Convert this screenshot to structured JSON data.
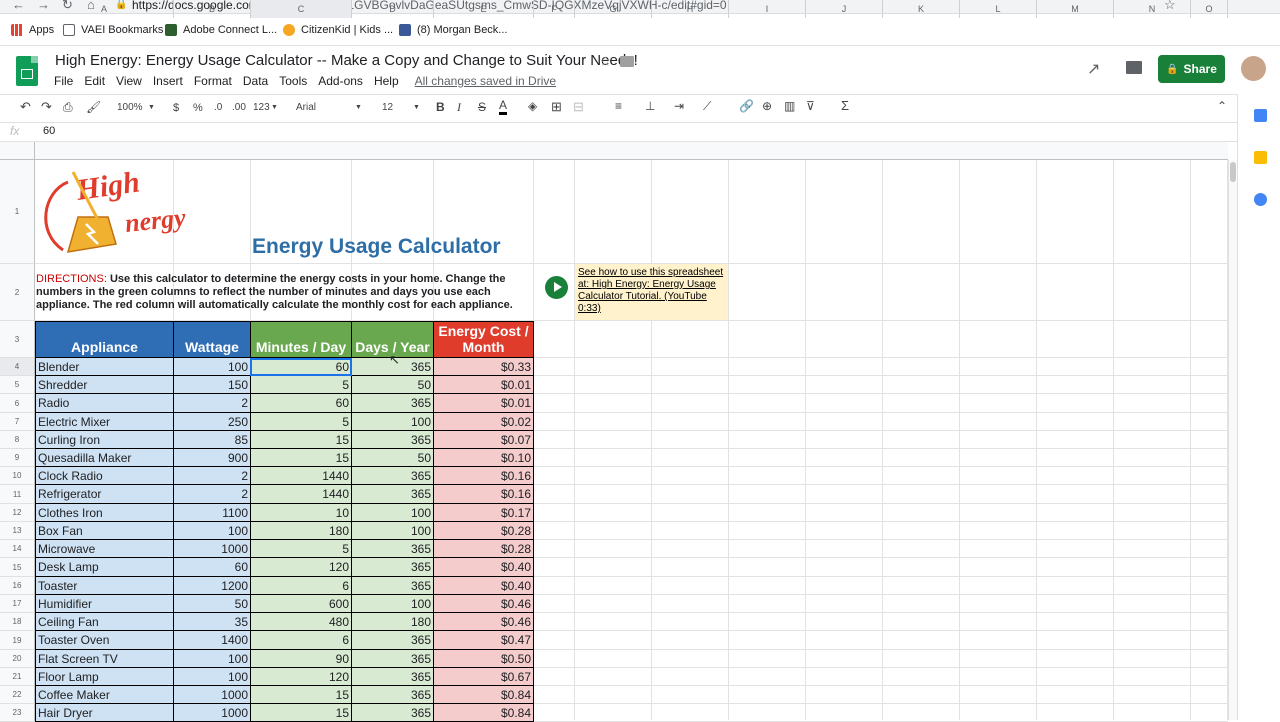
{
  "browser": {
    "url_host": "https://docs.google.com",
    "url_path": "/spreadsheets/d/1GVBGovlvDaGeaSUtgsms_CmwSD-IQGXMzeVqjVXWH-c/edit#gid=0",
    "bookmarks": [
      "Apps",
      "VAEI Bookmarks",
      "Adobe Connect L...",
      "CitizenKid | Kids ...",
      "(8) Morgan Beck..."
    ]
  },
  "doc": {
    "title": "High Energy: Energy Usage Calculator -- Make a Copy and Change to Suit Your Needs!",
    "menu": [
      "File",
      "Edit",
      "View",
      "Insert",
      "Format",
      "Data",
      "Tools",
      "Add-ons",
      "Help"
    ],
    "saved_status": "All changes saved in Drive",
    "share_label": "Share"
  },
  "toolbar": {
    "zoom": "100%",
    "currency": "$",
    "percent": "%",
    "dec_less": ".0",
    "dec_more": ".00",
    "more_formats": "123",
    "font": "Arial",
    "font_size": "12",
    "bold": "B",
    "italic": "I",
    "strike": "S",
    "textcolor": "A",
    "sum": "Σ"
  },
  "formula_bar": {
    "fx": "fx",
    "value": "60"
  },
  "columns": [
    "A",
    "B",
    "C",
    "D",
    "E",
    "F",
    "G",
    "H",
    "I",
    "J",
    "K",
    "L",
    "M",
    "N",
    "O"
  ],
  "sheet": {
    "logo_text_1": "High",
    "logo_text_2": "nergy",
    "title": "Energy Usage Calculator",
    "directions_label": "DIRECTIONS:",
    "directions_text": "Use this calculator to determine the energy costs in your home. Change the numbers in the green columns to reflect the number of minutes and days you use each appliance. The red column will automatically calculate the monthly cost for each appliance.",
    "note": "See how to use this spreadsheet at: High Energy: Energy Usage Calculator Tutorial. (YouTube 0:33)",
    "headers": [
      "Appliance",
      "Wattage",
      "Minutes / Day",
      "Days / Year",
      "Energy Cost / Month"
    ],
    "rows": [
      [
        "Blender",
        "100",
        "60",
        "365",
        "$0.33"
      ],
      [
        "Shredder",
        "150",
        "5",
        "50",
        "$0.01"
      ],
      [
        "Radio",
        "2",
        "60",
        "365",
        "$0.01"
      ],
      [
        "Electric Mixer",
        "250",
        "5",
        "100",
        "$0.02"
      ],
      [
        "Curling Iron",
        "85",
        "15",
        "365",
        "$0.07"
      ],
      [
        "Quesadilla Maker",
        "900",
        "15",
        "50",
        "$0.10"
      ],
      [
        "Clock Radio",
        "2",
        "1440",
        "365",
        "$0.16"
      ],
      [
        "Refrigerator",
        "2",
        "1440",
        "365",
        "$0.16"
      ],
      [
        "Clothes Iron",
        "1100",
        "10",
        "100",
        "$0.17"
      ],
      [
        "Box Fan",
        "100",
        "180",
        "100",
        "$0.28"
      ],
      [
        "Microwave",
        "1000",
        "5",
        "365",
        "$0.28"
      ],
      [
        "Desk Lamp",
        "60",
        "120",
        "365",
        "$0.40"
      ],
      [
        "Toaster",
        "1200",
        "6",
        "365",
        "$0.40"
      ],
      [
        "Humidifier",
        "50",
        "600",
        "100",
        "$0.46"
      ],
      [
        "Ceiling Fan",
        "35",
        "480",
        "180",
        "$0.46"
      ],
      [
        "Toaster Oven",
        "1400",
        "6",
        "365",
        "$0.47"
      ],
      [
        "Flat Screen TV",
        "100",
        "90",
        "365",
        "$0.50"
      ],
      [
        "Floor Lamp",
        "100",
        "120",
        "365",
        "$0.67"
      ],
      [
        "Coffee Maker",
        "1000",
        "15",
        "365",
        "$0.84"
      ],
      [
        "Hair Dryer",
        "1000",
        "15",
        "365",
        "$0.84"
      ]
    ],
    "row_numbers": [
      "1",
      "2",
      "3",
      "4",
      "5",
      "6",
      "7",
      "8",
      "9",
      "10",
      "11",
      "12",
      "13",
      "14",
      "15",
      "16",
      "17",
      "18",
      "19",
      "20",
      "21",
      "22",
      "23"
    ]
  },
  "colors": {
    "header_blue": "#2f6db5",
    "header_green": "#6aa84f",
    "header_red": "#e03c2c",
    "cell_blue": "#cfe2f3",
    "cell_green": "#d9ead3",
    "cell_red": "#f4cccc",
    "share_green": "#188038"
  }
}
